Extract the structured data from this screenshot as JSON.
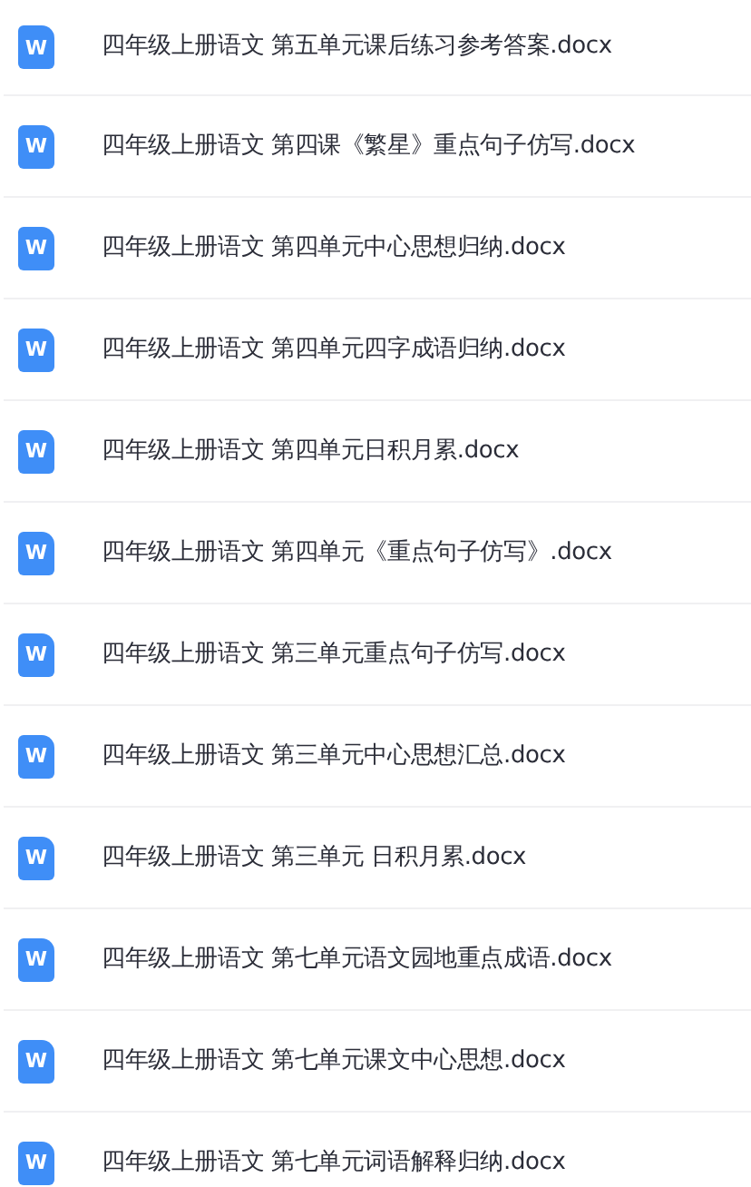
{
  "files": [
    {
      "icon_letter": "W",
      "name": "四年级上册语文 第五单元课后练习参考答案.docx"
    },
    {
      "icon_letter": "W",
      "name": "四年级上册语文 第四课《繁星》重点句子仿写.docx"
    },
    {
      "icon_letter": "W",
      "name": "四年级上册语文 第四单元中心思想归纳.docx"
    },
    {
      "icon_letter": "W",
      "name": "四年级上册语文 第四单元四字成语归纳.docx"
    },
    {
      "icon_letter": "W",
      "name": "四年级上册语文 第四单元日积月累.docx"
    },
    {
      "icon_letter": "W",
      "name": "四年级上册语文 第四单元《重点句子仿写》.docx"
    },
    {
      "icon_letter": "W",
      "name": "四年级上册语文 第三单元重点句子仿写.docx"
    },
    {
      "icon_letter": "W",
      "name": "四年级上册语文 第三单元中心思想汇总.docx"
    },
    {
      "icon_letter": "W",
      "name": "四年级上册语文 第三单元 日积月累.docx"
    },
    {
      "icon_letter": "W",
      "name": "四年级上册语文 第七单元语文园地重点成语.docx"
    },
    {
      "icon_letter": "W",
      "name": "四年级上册语文 第七单元课文中心思想.docx"
    },
    {
      "icon_letter": "W",
      "name": "四年级上册语文 第七单元词语解释归纳.docx"
    }
  ]
}
